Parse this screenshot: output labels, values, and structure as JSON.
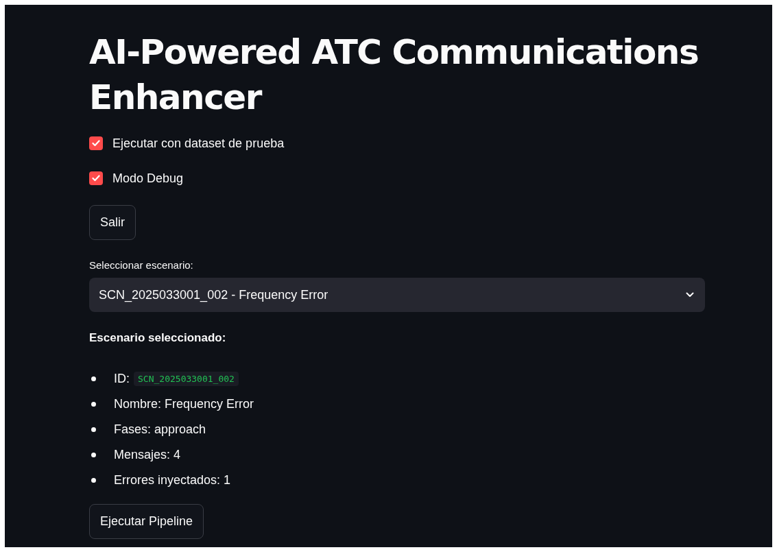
{
  "title": "AI-Powered ATC Communications Enhancer",
  "checkboxes": [
    {
      "label": "Ejecutar con dataset de prueba",
      "checked": true
    },
    {
      "label": "Modo Debug",
      "checked": true
    }
  ],
  "exit_button": "Salir",
  "scenario_select": {
    "label": "Seleccionar escenario:",
    "value": "SCN_2025033001_002 - Frequency Error"
  },
  "selected_heading": "Escenario seleccionado:",
  "details": [
    {
      "kind": "code",
      "label": "ID:",
      "value": "SCN_2025033001_002"
    },
    {
      "kind": "text",
      "text": "Nombre: Frequency Error"
    },
    {
      "kind": "text",
      "text": "Fases: approach"
    },
    {
      "kind": "text",
      "text": "Mensajes: 4"
    },
    {
      "kind": "text",
      "text": "Errores inyectados: 1"
    }
  ],
  "run_button": "Ejecutar Pipeline"
}
